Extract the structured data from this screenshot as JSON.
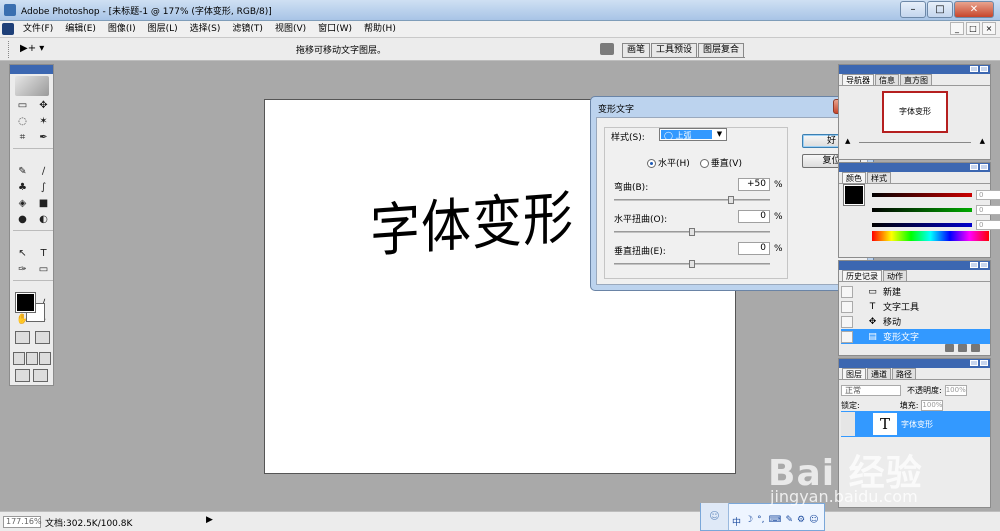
{
  "window": {
    "title": "Adobe Photoshop - [未标题-1 @ 177% (字体变形, RGB/8)]",
    "controls": {
      "minimize": "–",
      "maximize": "□",
      "close": "✕"
    }
  },
  "menu": {
    "items": [
      "文件(F)",
      "编辑(E)",
      "图像(I)",
      "图层(L)",
      "选择(S)",
      "滤镜(T)",
      "视图(V)",
      "窗口(W)",
      "帮助(H)"
    ],
    "doc_controls": [
      "_",
      "□",
      "×"
    ]
  },
  "options_bar": {
    "tool_preset": "▶+ ▾",
    "hint": "拖移可移动文字图层。",
    "palette_tabs": [
      "画笔",
      "工具预设",
      "图层复合"
    ]
  },
  "toolbox": {
    "tools": [
      "▭",
      "✥",
      "◌",
      "✶",
      "⌗",
      "✒",
      "✎",
      "∕",
      "♣",
      "∫",
      "◈",
      "■",
      "●",
      "◐",
      "↖",
      "T",
      "✑",
      "▭",
      "▤",
      "∕",
      "✋",
      "⌕"
    ]
  },
  "document": {
    "text": "字体变形"
  },
  "dialog": {
    "title": "变形文字",
    "close": "✕",
    "style_label": "样式(S):",
    "style_value": "◯ 上弧",
    "style_arrow": "▼",
    "orientation": {
      "horizontal": "水平(H)",
      "vertical": "垂直(V)",
      "selected": "horizontal"
    },
    "params": [
      {
        "label": "弯曲(B):",
        "value": "+50",
        "unit": "%",
        "level": 50
      },
      {
        "label": "水平扭曲(O):",
        "value": "0",
        "unit": "%",
        "level": 0
      },
      {
        "label": "垂直扭曲(E):",
        "value": "0",
        "unit": "%",
        "level": 0
      }
    ],
    "ok": "好",
    "reset": "复位"
  },
  "navigator": {
    "tabs": [
      "导航器",
      "信息",
      "直方图"
    ],
    "thumb_text": "字体变形",
    "zoom_out": "▲",
    "zoom_in": "▲"
  },
  "color": {
    "tabs": [
      "颜色",
      "样式"
    ],
    "values": [
      "0",
      "0",
      "0"
    ],
    "channel_colors": [
      "#cc0000",
      "#00aa00",
      "#0000cc"
    ]
  },
  "history": {
    "tabs": [
      "历史记录",
      "动作"
    ],
    "items": [
      {
        "icon": "▭",
        "label": "新建",
        "selected": false
      },
      {
        "icon": "T",
        "label": "文字工具",
        "selected": false
      },
      {
        "icon": "✥",
        "label": "移动",
        "selected": false
      },
      {
        "icon": "▤",
        "label": "变形文字",
        "selected": true
      }
    ]
  },
  "layers": {
    "tabs": [
      "图层",
      "通道",
      "路径"
    ],
    "blend_mode": "正常",
    "opacity_label": "不透明度:",
    "opacity_value": "100%",
    "lock_label": "锁定:",
    "fill_label": "填充:",
    "fill_value": "100%",
    "layer_name": "字体变形",
    "layer_thumb": "T"
  },
  "status": {
    "zoom": "177.16%",
    "doc_size": "文档:302.5K/100.8K",
    "arrow": "▶"
  },
  "ime": {
    "avatar": "☺",
    "items": [
      "中",
      "☽",
      "°,",
      "⌨",
      "✎",
      "⚙",
      "☺"
    ]
  },
  "watermark": {
    "logo": "Bai 经验",
    "url": "jingyan.baidu.com"
  }
}
